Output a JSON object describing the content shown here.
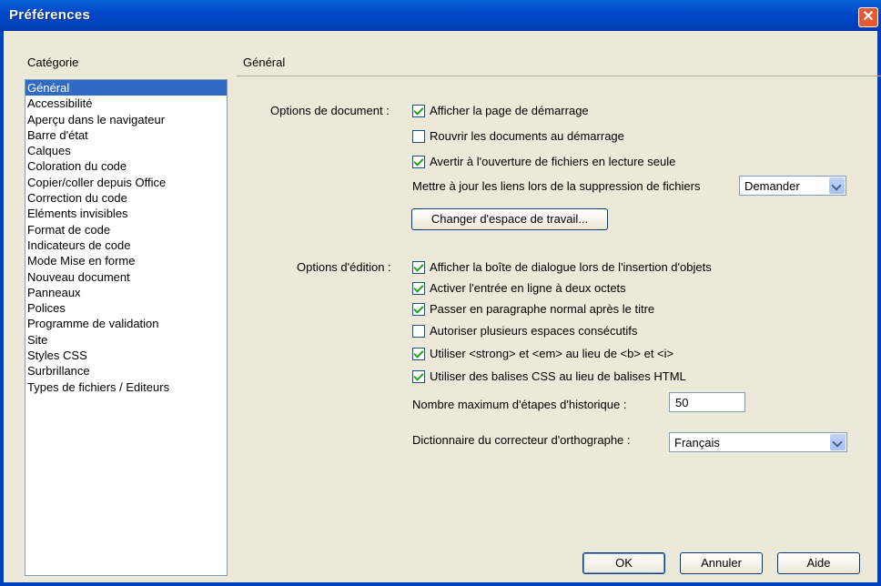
{
  "window": {
    "title": "Préférences",
    "close": "✕"
  },
  "category": {
    "header": "Catégorie",
    "items": [
      "Général",
      "Accessibilité",
      "Aperçu dans le navigateur",
      "Barre d'état",
      "Calques",
      "Coloration du code",
      "Copier/coller depuis Office",
      "Correction du code",
      "Eléments invisibles",
      "Format de code",
      "Indicateurs de code",
      "Mode Mise en forme",
      "Nouveau document",
      "Panneaux",
      "Polices",
      "Programme de validation",
      "Site",
      "Styles CSS",
      "Surbrillance",
      "Types de fichiers / Editeurs"
    ],
    "selected": "Général"
  },
  "panel": {
    "title": "Général",
    "document_options": {
      "label": "Options de document :",
      "show_start_page": {
        "label": "Afficher la page de démarrage",
        "checked": true
      },
      "reopen_docs": {
        "label": "Rouvrir les documents au démarrage",
        "checked": false
      },
      "warn_readonly": {
        "label": "Avertir à l'ouverture de fichiers en lecture seule",
        "checked": true
      },
      "update_links_label": "Mettre à jour les liens lors de la suppression de fichiers",
      "update_links_value": "Demander",
      "change_workspace": "Changer d'espace de travail..."
    },
    "edit_options": {
      "label": "Options d'édition :",
      "show_insert_dialog": {
        "label": "Afficher la boîte de dialogue lors de l'insertion d'objets",
        "checked": true
      },
      "double_byte": {
        "label": "Activer l'entrée en ligne à deux octets",
        "checked": true
      },
      "normal_paragraph": {
        "label": "Passer en paragraphe normal après le titre",
        "checked": true
      },
      "multiple_spaces": {
        "label": "Autoriser plusieurs espaces consécutifs",
        "checked": false
      },
      "strong_em": {
        "label": "Utiliser <strong> et <em> au lieu de <b> et <i>",
        "checked": true
      },
      "css_tags": {
        "label": "Utiliser des balises CSS au lieu de balises HTML",
        "checked": true
      },
      "history_label": "Nombre maximum d'étapes d'historique :",
      "history_value": "50",
      "dictionary_label": "Dictionnaire du correcteur d'orthographe :",
      "dictionary_value": "Français"
    }
  },
  "buttons": {
    "ok": "OK",
    "cancel": "Annuler",
    "help": "Aide"
  }
}
